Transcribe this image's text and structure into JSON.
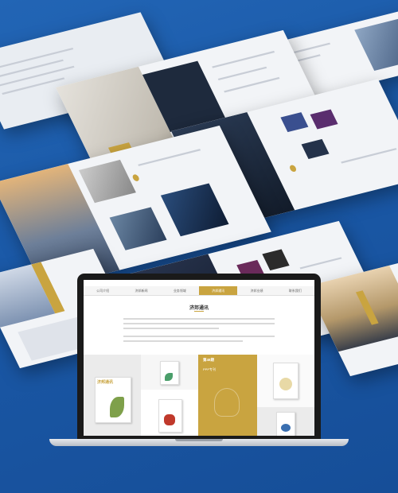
{
  "nav": {
    "tabs": [
      {
        "label": "公司介绍"
      },
      {
        "label": "济邦新闻"
      },
      {
        "label": "业务领域"
      },
      {
        "label": "济邦通讯"
      },
      {
        "label": "济邦业绩"
      },
      {
        "label": "联系我们"
      }
    ],
    "active_index": 3
  },
  "section": {
    "title": "济邦通讯"
  },
  "featured": {
    "issue": "第48期",
    "issue_sub": "PPP专刊"
  },
  "covers": {
    "title": "济邦通讯"
  },
  "colors": {
    "accent": "#c9a440",
    "background": "#1a5aa8",
    "dark": "#1e2a3d"
  }
}
